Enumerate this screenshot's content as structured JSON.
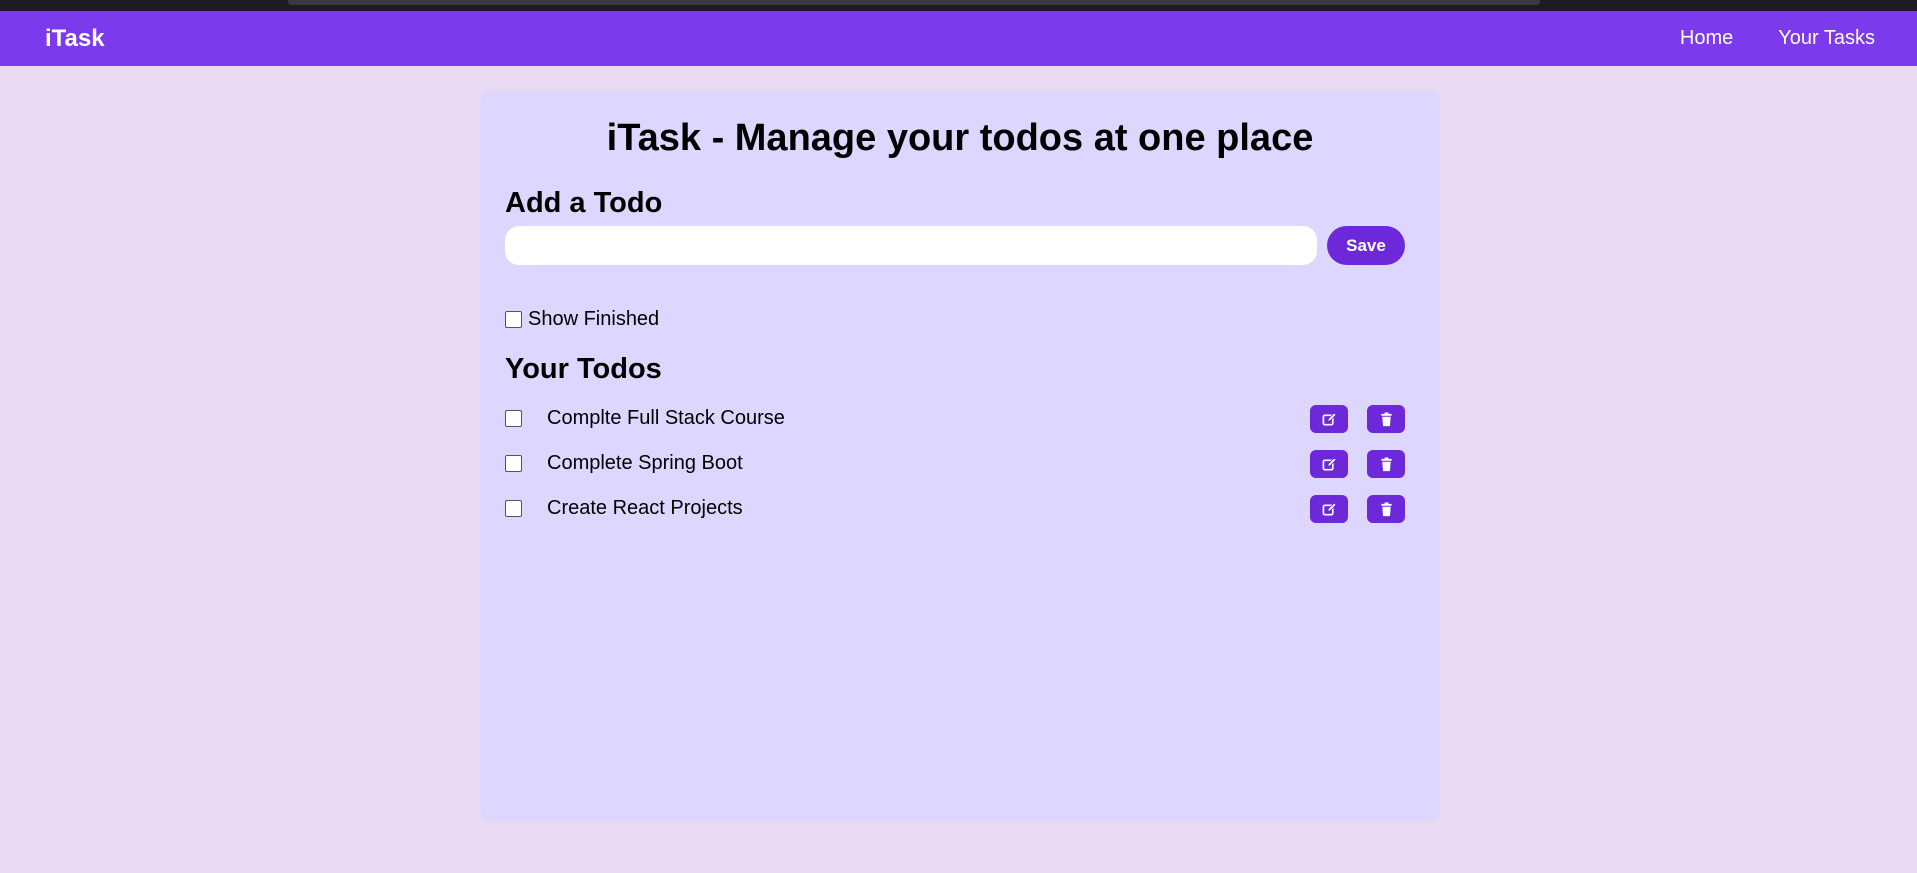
{
  "nav": {
    "logo": "iTask",
    "links": [
      "Home",
      "Your Tasks"
    ]
  },
  "main": {
    "title": "iTask - Manage your todos at one place",
    "add_heading": "Add a Todo",
    "input_value": "",
    "input_placeholder": "",
    "save_label": "Save",
    "show_finished_label": "Show Finished",
    "show_finished_checked": false,
    "todos_heading": "Your Todos",
    "todos": [
      {
        "text": "Complte Full Stack Course",
        "done": false
      },
      {
        "text": "Complete Spring Boot",
        "done": false
      },
      {
        "text": "Create React Projects",
        "done": false
      }
    ],
    "edit_icon": "edit-icon",
    "delete_icon": "trash-icon"
  },
  "colors": {
    "nav_bg": "#7c3aed",
    "page_bg": "#e9daf4",
    "card_bg": "#ddd6fe",
    "button_bg": "#6d28d9"
  }
}
